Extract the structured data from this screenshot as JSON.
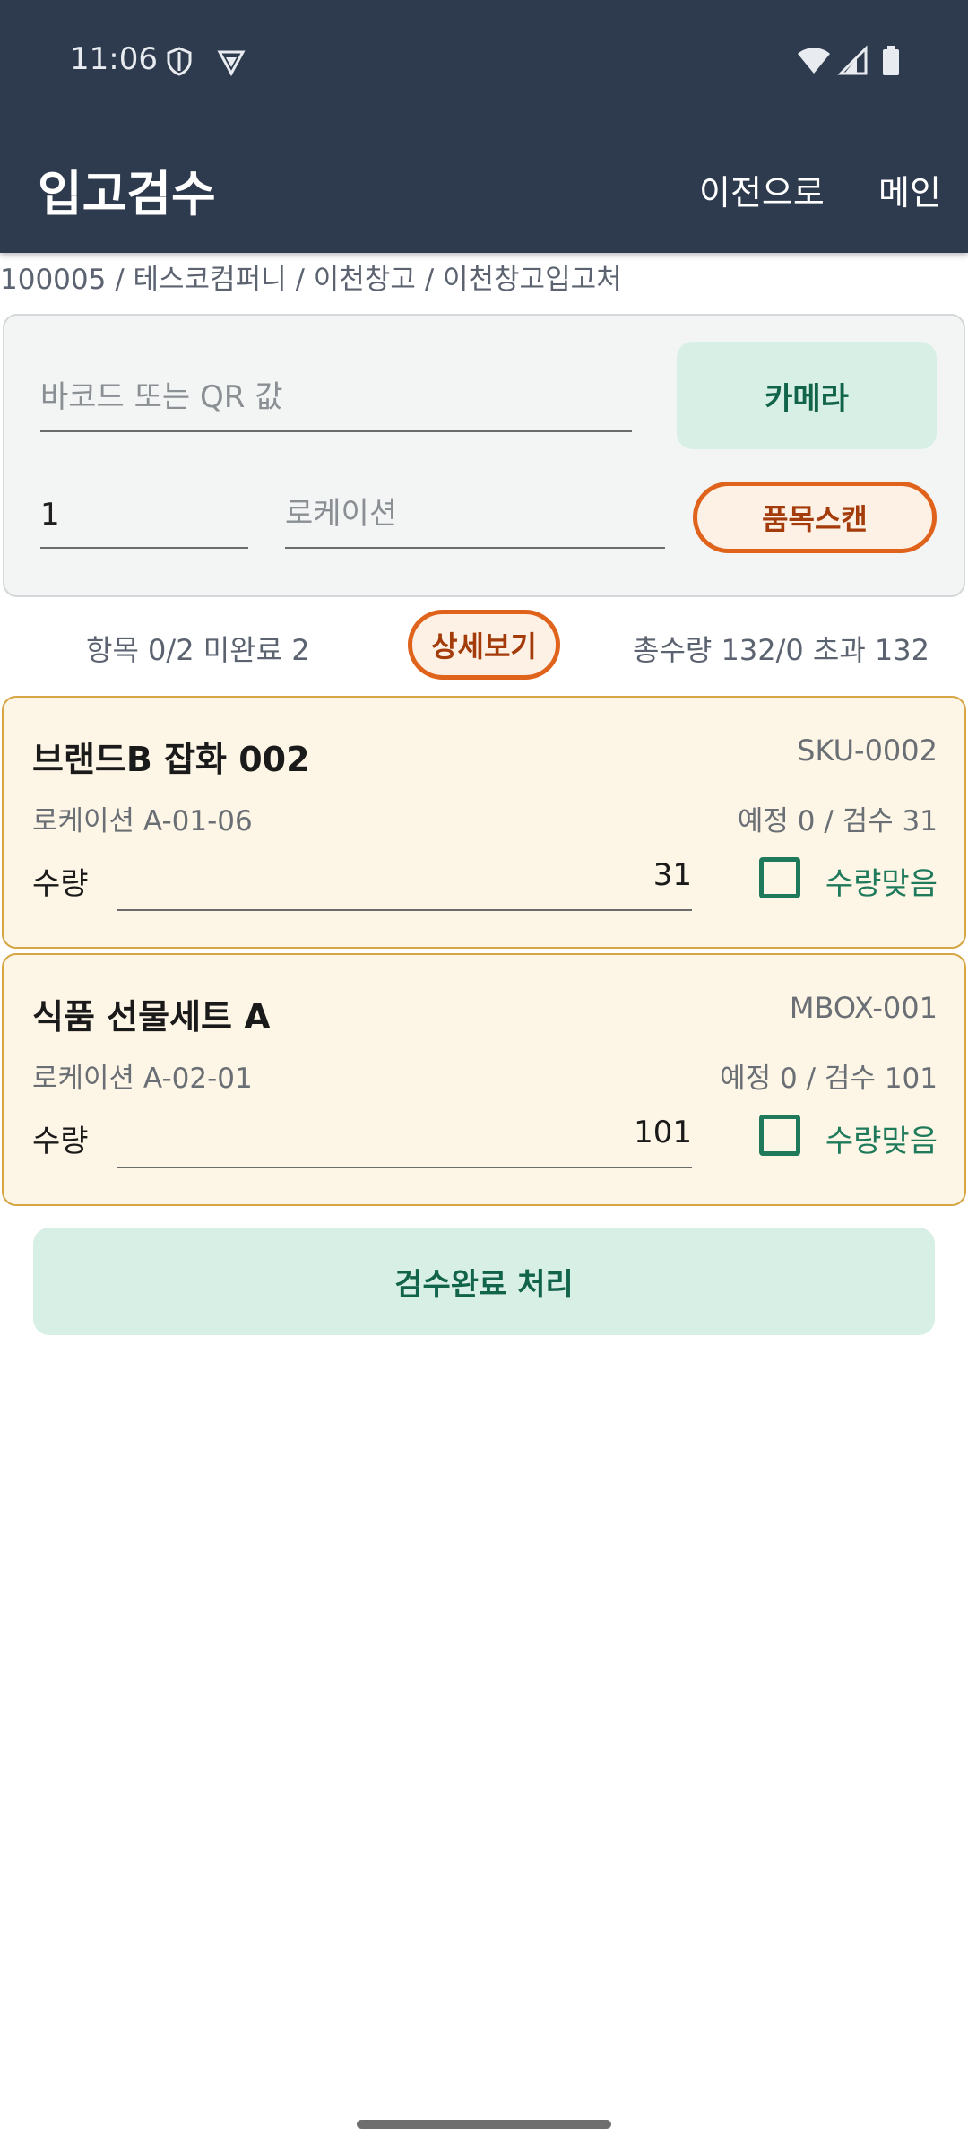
{
  "status_bar": {
    "time": "11:06",
    "icons": [
      "shield-icon",
      "vpn-icon",
      "wifi-icon",
      "signal-icon",
      "battery-icon"
    ]
  },
  "toolbar": {
    "title": "입고검수",
    "back_label": "이전으로",
    "main_label": "메인"
  },
  "breadcrumb": "100005 / 테스코컴퍼니 / 이천창고 / 이천창고입고처",
  "scan": {
    "barcode_placeholder": "바코드 또는 QR 값",
    "camera_label": "카메라",
    "quantity_value": "1",
    "location_placeholder": "로케이션",
    "item_scan_label": "품목스캔"
  },
  "summary": {
    "items_text": "항목 0/2 미완료 2",
    "detail_label": "상세보기",
    "total_text": "총수량 132/0 초과 132"
  },
  "items": [
    {
      "name": "브랜드B 잡화 002",
      "sku": "SKU-0002",
      "location": "로케이션 A-01-06",
      "plan": "예정 0 / 검수 31",
      "qty_label": "수량",
      "qty_value": "31",
      "check_label": "수량맞음"
    },
    {
      "name": "식품 선물세트 A",
      "sku": "MBOX-001",
      "location": "로케이션 A-02-01",
      "plan": "예정 0 / 검수 101",
      "qty_label": "수량",
      "qty_value": "101",
      "check_label": "수량맞음"
    }
  ],
  "complete_label": "검수완료 처리",
  "colors": {
    "appbar": "#2e3b4e",
    "accent_green": "#1f7a5c",
    "accent_orange": "#e0631c",
    "card_bg": "#fdf5e5",
    "card_border": "#d6a544"
  }
}
